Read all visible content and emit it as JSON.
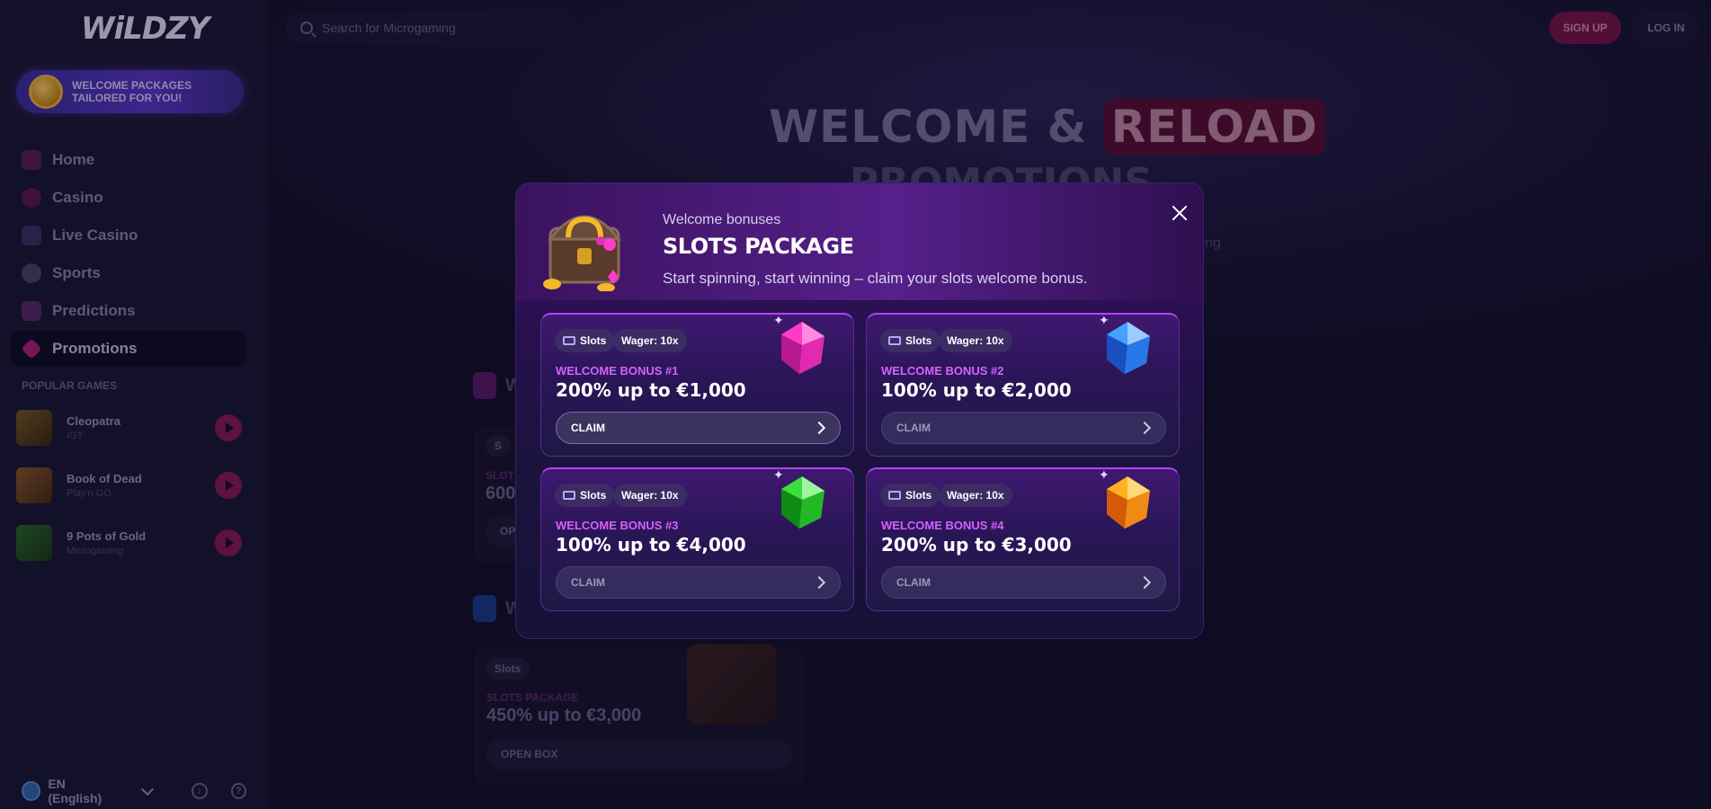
{
  "brand": {
    "logo_text": "WiLDZY"
  },
  "sidebar": {
    "welcome_banner": "WELCOME PACKAGES TAILORED FOR YOU!",
    "nav": [
      {
        "label": "Home",
        "icon": "home-icon",
        "color": "#7a2d6b"
      },
      {
        "label": "Casino",
        "icon": "casino-icon",
        "color": "#6a1f5e"
      },
      {
        "label": "Live Casino",
        "icon": "live-casino-icon",
        "color": "#4a4478"
      },
      {
        "label": "Sports",
        "icon": "sports-icon",
        "color": "#5a5478"
      },
      {
        "label": "Predictions",
        "icon": "predictions-icon",
        "color": "#6a3078"
      },
      {
        "label": "Promotions",
        "icon": "promotions-icon",
        "color": "#b31e7a"
      }
    ],
    "popular_title": "POPULAR GAMES",
    "popular_games": [
      {
        "name": "Cleopatra",
        "provider": "IGT"
      },
      {
        "name": "Book of Dead",
        "provider": "Play'n GO"
      },
      {
        "name": "9 Pots of Gold",
        "provider": "Microgaming"
      }
    ],
    "language": "EN (English)",
    "support_icon": "headset-icon",
    "help_icon": "question-icon"
  },
  "topbar": {
    "search_placeholder": "Search for Microgaming",
    "signup_label": "SIGN UP",
    "login_label": "LOG IN"
  },
  "hero": {
    "title_part1": "WELCOME &",
    "title_highlight": "RELOAD",
    "title_line2": "PROMOTIONS",
    "partial_text": "ng"
  },
  "background_sections": [
    {
      "title": "W",
      "tag": "S",
      "label": "SLOT",
      "value": "600",
      "button": "OP"
    },
    {
      "title": "W",
      "tag": "Slots",
      "label": "SLOTS PACKAGE",
      "value": "450% up to €3,000",
      "button": "OPEN BOX"
    }
  ],
  "modal": {
    "eyebrow": "Welcome bonuses",
    "title": "SLOTS PACKAGE",
    "description": "Start spinning, start winning – claim your slots welcome bonus.",
    "close_icon": "close-icon",
    "bonuses": [
      {
        "category": "Slots",
        "wager": "Wager: 10x",
        "label": "WELCOME BONUS #1",
        "value": "200% up to €1,000",
        "button": "CLAIM",
        "gem_color": "#ff3cc8",
        "gem_dark": "#a0127c"
      },
      {
        "category": "Slots",
        "wager": "Wager: 10x",
        "label": "WELCOME BONUS #2",
        "value": "100% up to €2,000",
        "button": "CLAIM",
        "gem_color": "#46a0ff",
        "gem_dark": "#1a4fc0"
      },
      {
        "category": "Slots",
        "wager": "Wager: 10x",
        "label": "WELCOME BONUS #3",
        "value": "100% up to €4,000",
        "button": "CLAIM",
        "gem_color": "#3cdc3c",
        "gem_dark": "#0f8a14"
      },
      {
        "category": "Slots",
        "wager": "Wager: 10x",
        "label": "WELCOME BONUS #4",
        "value": "200% up to €3,000",
        "button": "CLAIM",
        "gem_color": "#ffb21e",
        "gem_dark": "#d45a0a"
      }
    ]
  }
}
